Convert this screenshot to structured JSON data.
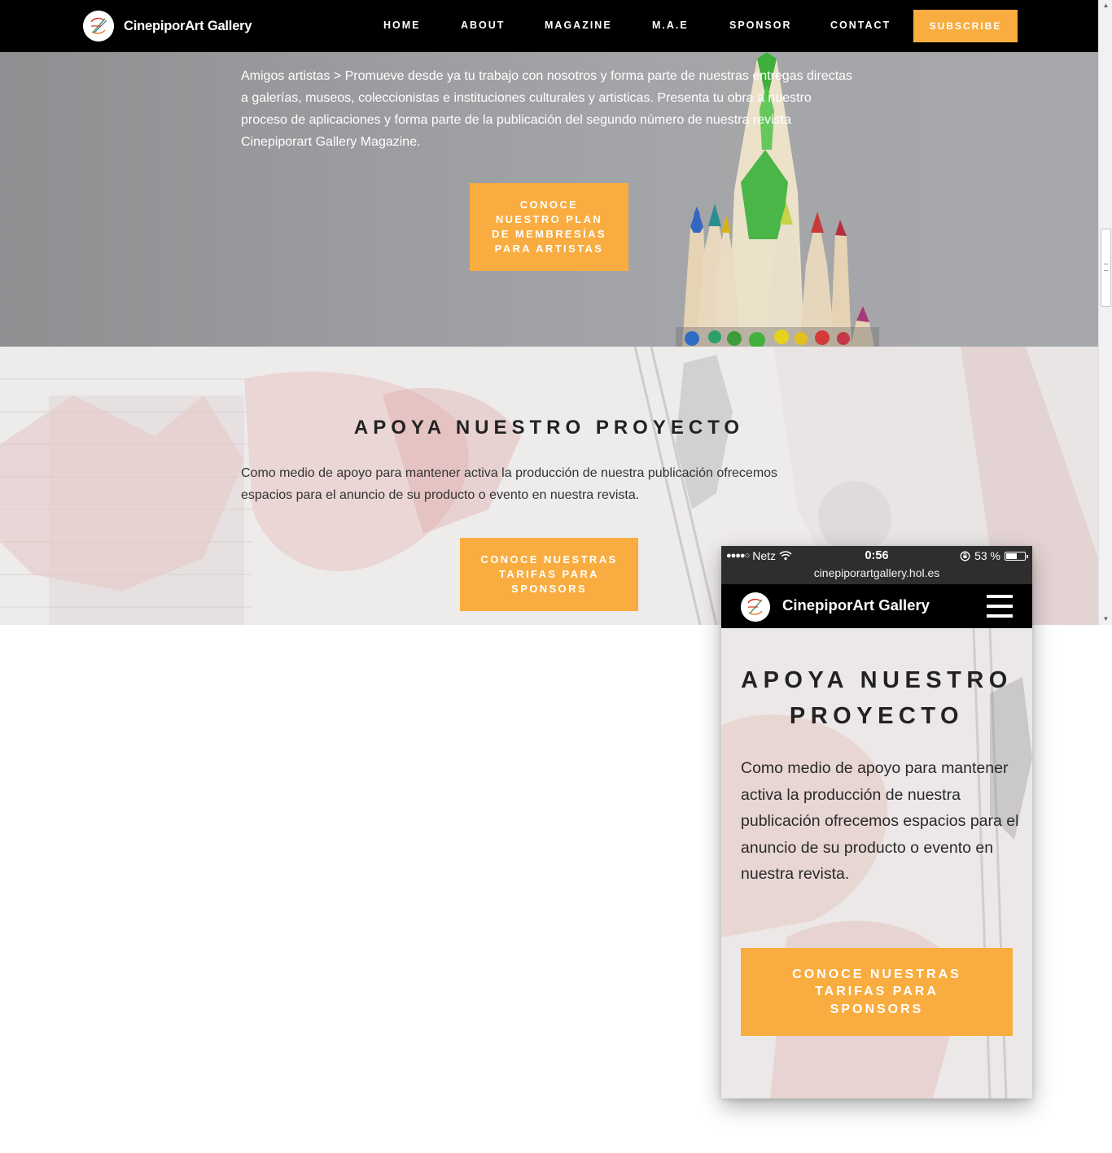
{
  "site": {
    "brand_name": "CinepiporArt Gallery",
    "logo_icon": "palette-logo-icon"
  },
  "nav": {
    "items": [
      "HOME",
      "ABOUT",
      "MAGAZINE",
      "M.A.E",
      "SPONSOR",
      "CONTACT"
    ],
    "subscribe_label": "SUBSCRIBE"
  },
  "hero": {
    "text": "Amigos artistas > Promueve desde ya tu trabajo con nosotros y forma parte de nuestras entregas directas a galerías, museos, coleccionistas e instituciones culturales y artisticas. Presenta tu obra a nuestro proceso de aplicaciones y forma parte de la publicación del segundo número de nuestra revista Cinepiporart Gallery Magazine.",
    "button_label": "CONOCE NUESTRO PLAN DE MEMBRESÍAS PARA ARTISTAS",
    "background": "colored-pencils-photo"
  },
  "support": {
    "title": "APOYA NUESTRO PROYECTO",
    "text": "Como medio de apoyo para mantener activa la producción de nuestra publicación ofrecemos espacios para el anuncio de su producto o evento en nuestra revista.",
    "button_label": "CONOCE NUESTRAS TARIFAS PARA SPONSORS",
    "background": "graffiti-wall-photo"
  },
  "phone": {
    "status": {
      "carrier": "Netz",
      "time": "0:56",
      "battery": "53 %",
      "battery_level": 0.53,
      "url": "cinepiporartgallery.hol.es"
    },
    "brand_name": "CinepiporArt Gallery",
    "title": "APOYA NUESTRO PROYECTO",
    "text": "Como medio de apoyo para mantener activa la producción de nuestra publicación ofrecemos espacios para el anuncio de su producto o evento en nuestra revista.",
    "button_label": "CONOCE NUESTRAS TARIFAS PARA SPONSORS"
  },
  "colors": {
    "accent": "#F9AC3F",
    "nav_background": "#000000",
    "text_dark": "#222222",
    "text_light": "#FFFFFF"
  }
}
